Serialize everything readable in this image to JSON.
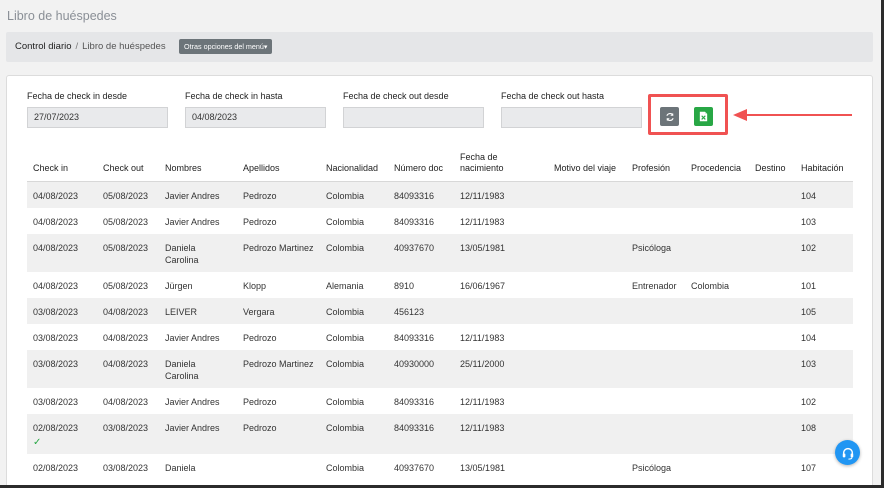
{
  "page": {
    "title": "Libro de huéspedes"
  },
  "breadcrumb": {
    "root": "Control diario",
    "separator": "/",
    "current": "Libro de huéspedes",
    "menu_button": "Otras opciones del menú"
  },
  "filters": {
    "checkin_from": {
      "label": "Fecha de check in desde",
      "value": "27/07/2023"
    },
    "checkin_to": {
      "label": "Fecha de check in hasta",
      "value": "04/08/2023"
    },
    "checkout_from": {
      "label": "Fecha de check out desde",
      "value": ""
    },
    "checkout_to": {
      "label": "Fecha de check out hasta",
      "value": ""
    }
  },
  "table": {
    "headers": [
      "Check in",
      "Check out",
      "Nombres",
      "Apellidos",
      "Nacionalidad",
      "Número doc",
      "Fecha de nacimiento",
      "Motivo del viaje",
      "Profesión",
      "Procedencia",
      "Destino",
      "Habitación"
    ],
    "rows": [
      [
        "04/08/2023",
        "05/08/2023",
        "Javier Andres",
        "Pedrozo",
        "Colombia",
        "84093316",
        "12/11/1983",
        "",
        "",
        "",
        "",
        "104"
      ],
      [
        "04/08/2023",
        "05/08/2023",
        "Javier Andres",
        "Pedrozo",
        "Colombia",
        "84093316",
        "12/11/1983",
        "",
        "",
        "",
        "",
        "103"
      ],
      [
        "04/08/2023",
        "05/08/2023",
        "Daniela Carolina",
        "Pedrozo Martinez",
        "Colombia",
        "40937670",
        "13/05/1981",
        "",
        "Psicóloga",
        "",
        "",
        "102"
      ],
      [
        "04/08/2023",
        "05/08/2023",
        "Jürgen",
        "Klopp",
        "Alemania",
        "8910",
        "16/06/1967",
        "",
        "Entrenador",
        "Colombia",
        "",
        "101"
      ],
      [
        "03/08/2023",
        "04/08/2023",
        "LEIVER",
        "Vergara",
        "Colombia",
        "456123",
        "",
        "",
        "",
        "",
        "",
        "105"
      ],
      [
        "03/08/2023",
        "04/08/2023",
        "Javier Andres",
        "Pedrozo",
        "Colombia",
        "84093316",
        "12/11/1983",
        "",
        "",
        "",
        "",
        "104"
      ],
      [
        "03/08/2023",
        "04/08/2023",
        "Daniela Carolina",
        "Pedrozo Martinez",
        "Colombia",
        "40930000",
        "25/11/2000",
        "",
        "",
        "",
        "",
        "103"
      ],
      [
        "03/08/2023",
        "04/08/2023",
        "Javier Andres",
        "Pedrozo",
        "Colombia",
        "84093316",
        "12/11/1983",
        "",
        "",
        "",
        "",
        "102"
      ],
      [
        "02/08/2023",
        "03/08/2023",
        "Javier Andres",
        "Pedrozo",
        "Colombia",
        "84093316",
        "12/11/1983",
        "",
        "",
        "",
        "",
        "108"
      ],
      [
        "02/08/2023",
        "03/08/2023",
        "Daniela",
        "",
        "Colombia",
        "40937670",
        "13/05/1981",
        "",
        "Psicóloga",
        "",
        "",
        "107"
      ]
    ],
    "checked_rows": [
      8
    ]
  },
  "icons": {
    "refresh": "refresh-icon",
    "excel": "excel-file-icon",
    "support": "headset-icon",
    "check": "check-icon"
  },
  "colors": {
    "highlight": "#f05252",
    "excel_button": "#28a745",
    "refresh_button": "#6c7479",
    "support_fab": "#2196f3"
  }
}
